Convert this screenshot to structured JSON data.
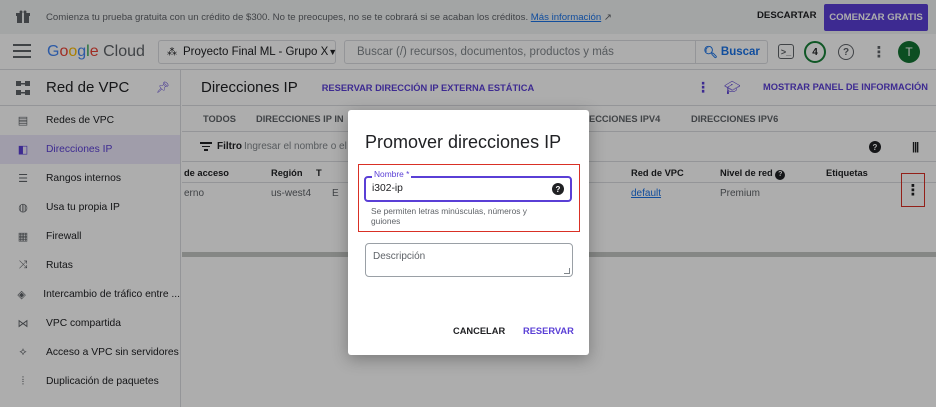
{
  "promo": {
    "text": "Comienza tu prueba gratuita con un crédito de $300. No te preocupes, no se te cobrará si se acaban los créditos.",
    "link": "Más información",
    "dismiss": "DESCARTAR",
    "start": "COMENZAR GRATIS"
  },
  "topbar": {
    "logo_g": "G",
    "logo_o1": "o",
    "logo_o2": "o",
    "logo_g2": "g",
    "logo_l": "l",
    "logo_e": "e",
    "logo_cloud": "Cloud",
    "project": "Proyecto Final ML - Grupo X",
    "search_placeholder": "Buscar (/) recursos, documentos, productos y más",
    "search_button": "Buscar",
    "notifications": "4",
    "avatar": "T"
  },
  "sidebar": {
    "title": "Red de VPC",
    "items": [
      {
        "label": "Redes de VPC",
        "icon": "network-icon"
      },
      {
        "label": "Direcciones IP",
        "icon": "ip-address-icon"
      },
      {
        "label": "Rangos internos",
        "icon": "ranges-icon"
      },
      {
        "label": "Usa tu propia IP",
        "icon": "globe-icon"
      },
      {
        "label": "Firewall",
        "icon": "firewall-icon"
      },
      {
        "label": "Rutas",
        "icon": "routes-icon"
      },
      {
        "label": "Intercambio de tráfico entre ...",
        "icon": "peering-icon"
      },
      {
        "label": "VPC compartida",
        "icon": "shared-vpc-icon"
      },
      {
        "label": "Acceso a VPC sin servidores",
        "icon": "serverless-icon"
      },
      {
        "label": "Duplicación de paquetes",
        "icon": "mirroring-icon"
      }
    ]
  },
  "page": {
    "title": "Direcciones IP",
    "reserve_static": "RESERVAR DIRECCIÓN IP EXTERNA ESTÁTICA",
    "show_info": "MOSTRAR PANEL DE INFORMACIÓN"
  },
  "tabs": {
    "all": "TODOS",
    "internal": "DIRECCIONES IP IN",
    "ipv4": "ECCIONES IPV4",
    "ipv6": "DIRECCIONES IPV6"
  },
  "filter": {
    "label": "Filtro",
    "placeholder": "Ingresar el nombre o el v"
  },
  "table": {
    "headers": [
      "de acceso",
      "Región",
      "T",
      "Red de VPC",
      "Nivel de red",
      "Etiquetas"
    ],
    "row": {
      "access": "erno",
      "region": "us-west4",
      "type": "E",
      "vpc": "default",
      "tier": "Premium"
    }
  },
  "dialog": {
    "title": "Promover direcciones IP",
    "name_label": "Nombre *",
    "name_value": "i302-ip",
    "hint": "Se permiten letras minúsculas, números y guiones",
    "description_label": "Descripción",
    "cancel": "CANCELAR",
    "reserve": "RESERVAR"
  }
}
